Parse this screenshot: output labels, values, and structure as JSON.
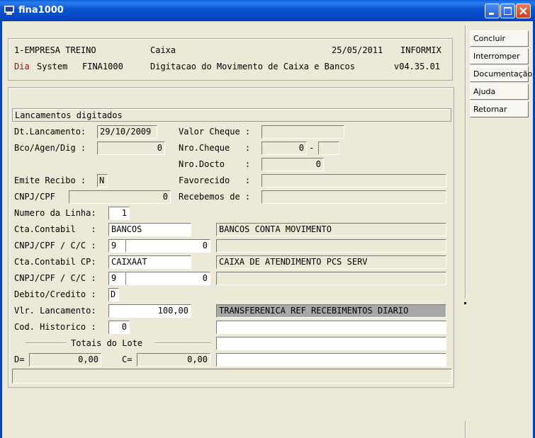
{
  "window": {
    "title": "fina1000"
  },
  "header": {
    "company": "1-EMPRESA TREINO",
    "module": "Caixa",
    "date": "25/05/2011",
    "db": "INFORMIX",
    "dia": "Dia",
    "system": "System",
    "program": "FINA1000",
    "description": "Digitacao do Movimento de Caixa e Bancos",
    "version": "v04.35.01"
  },
  "buttons": {
    "concluir": "Concluir",
    "interromper": "Interromper",
    "documentacao": "Documentação",
    "ajuda": "Ajuda",
    "retornar": "Retornar"
  },
  "form": {
    "section_title": "Lancamentos digitados",
    "dt_lancamento": {
      "label": "Dt.Lancamento:",
      "value": "29/10/2009"
    },
    "valor_cheque": {
      "label": "Valor Cheque :",
      "value": ""
    },
    "bco_agen_dig": {
      "label": "Bco/Agen/Dig :",
      "value": "0"
    },
    "nro_cheque": {
      "label": "Nro.Cheque   :",
      "value": "0",
      "sep": "-",
      "digit": ""
    },
    "nro_docto": {
      "label": "Nro.Docto    :",
      "value": "0"
    },
    "emite_recibo": {
      "label": "Emite Recibo :",
      "value": "N"
    },
    "favorecido": {
      "label": "Favorecido   :",
      "value": ""
    },
    "cnpj_cpf": {
      "label": "CNPJ/CPF",
      "value": "0"
    },
    "recebemos_de": {
      "label": "Recebemos de :",
      "value": ""
    },
    "numero_linha": {
      "label": "Numero da Linha:",
      "value": "1"
    },
    "cta_contabil": {
      "label": "Cta.Contabil   :",
      "value": "BANCOS",
      "desc": "BANCOS CONTA MOVIMENTO"
    },
    "cnpj_cc_1": {
      "label": "CNPJ/CPF / C/C :",
      "type": "9",
      "value": "0",
      "desc": ""
    },
    "cta_contabil_cp": {
      "label": "Cta.Contabil CP:",
      "value": "CAIXAAT",
      "desc": "CAIXA DE ATENDIMENTO PCS SERV"
    },
    "cnpj_cc_2": {
      "label": "CNPJ/CPF / C/C :",
      "type": "9",
      "value": "0",
      "desc": ""
    },
    "debito_credito": {
      "label": "Debito/Credito :",
      "value": "D"
    },
    "vlr_lancamento": {
      "label": "Vlr. Lancamento:",
      "value": "100,00",
      "desc": "TRANSFERENICA REF RECEBIMENTOS DIARIO"
    },
    "cod_historico": {
      "label": "Cod. Historico :",
      "value": "0",
      "desc": ""
    },
    "totais_title": "Totais do Lote",
    "total_d": {
      "label": "D=",
      "value": "0,00"
    },
    "total_c": {
      "label": "C=",
      "value": "0,00"
    },
    "extra_desc_1": "",
    "extra_desc_2": "",
    "status": ""
  }
}
